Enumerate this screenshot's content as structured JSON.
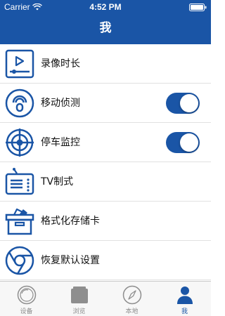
{
  "status_bar": {
    "carrier": "Carrier",
    "time": "4:52 PM"
  },
  "nav": {
    "title": "我"
  },
  "colors": {
    "accent": "#1a55a6",
    "tab_inactive": "#8e8e8e"
  },
  "settings": [
    {
      "label": "录像时长",
      "icon": "video-duration-icon"
    },
    {
      "label": "移动侦测",
      "icon": "motion-detection-icon",
      "toggle_on": true
    },
    {
      "label": "停车监控",
      "icon": "parking-monitor-icon",
      "toggle_on": true
    },
    {
      "label": "TV制式",
      "icon": "tv-icon"
    },
    {
      "label": "格式化存储卡",
      "icon": "format-card-icon"
    },
    {
      "label": "恢复默认设置",
      "icon": "restore-defaults-icon"
    }
  ],
  "tabs": [
    {
      "label": "设备",
      "icon": "device-icon",
      "active": false
    },
    {
      "label": "浏览",
      "icon": "browse-icon",
      "active": false
    },
    {
      "label": "本地",
      "icon": "compass-icon",
      "active": false
    },
    {
      "label": "我",
      "icon": "person-icon",
      "active": true
    }
  ]
}
